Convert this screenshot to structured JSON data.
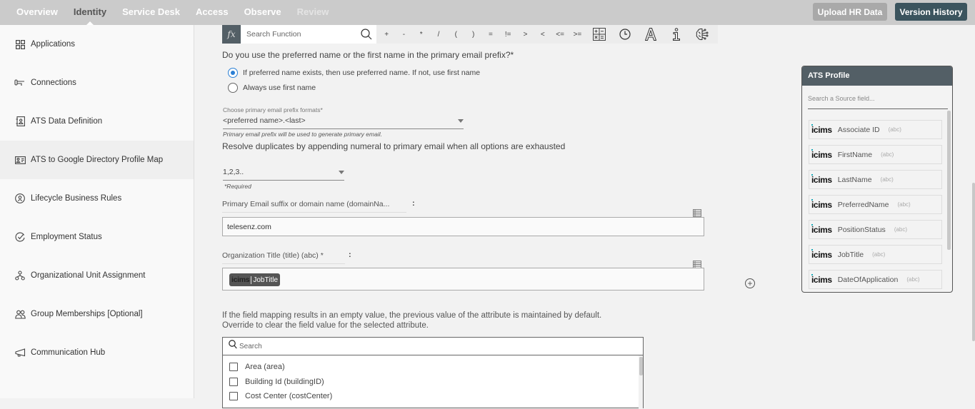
{
  "topnav": {
    "tabs": [
      {
        "label": "Overview",
        "state": "normal"
      },
      {
        "label": "Identity",
        "state": "active"
      },
      {
        "label": "Service Desk",
        "state": "normal"
      },
      {
        "label": "Access",
        "state": "normal"
      },
      {
        "label": "Observe",
        "state": "normal"
      },
      {
        "label": "Review",
        "state": "disabled"
      }
    ],
    "upload_label": "Upload HR Data",
    "version_label": "Version History"
  },
  "sidebar": {
    "items": [
      {
        "label": "Applications",
        "icon": "grid-icon"
      },
      {
        "label": "Connections",
        "icon": "key-connector-icon"
      },
      {
        "label": "ATS Data Definition",
        "icon": "contact-book-icon"
      },
      {
        "label": "ATS to Google Directory Profile Map",
        "icon": "id-card-icon",
        "active": true
      },
      {
        "label": "Lifecycle Business Rules",
        "icon": "user-circle-icon"
      },
      {
        "label": "Employment Status",
        "icon": "check-circle-icon"
      },
      {
        "label": "Organizational Unit Assignment",
        "icon": "org-tree-icon"
      },
      {
        "label": "Group Memberships [Optional]",
        "icon": "users-icon"
      },
      {
        "label": "Communication Hub",
        "icon": "megaphone-icon"
      }
    ]
  },
  "toolbar": {
    "fx_label": "fx",
    "search_placeholder": "Search Function",
    "operators": [
      "+",
      "-",
      "*",
      "/",
      "(",
      ")",
      "=",
      "!=",
      ">",
      "<",
      "<=",
      ">="
    ]
  },
  "form": {
    "name_question": "Do you use the preferred name or the first name in the primary email prefix?*",
    "radio_options": [
      {
        "label": "If preferred name exists, then use preferred name. If not, use first name",
        "selected": true
      },
      {
        "label": "Always use first name",
        "selected": false
      }
    ],
    "prefix_label": "Choose primary email prefix formats*",
    "prefix_value": "<preferred name>.<last>",
    "prefix_hint": "Primary email prefix will be used to generate primary email.",
    "duplicates_text": "Resolve duplicates by appending numeral to primary email when all options are exhausted",
    "duplicates_value": "1,2,3..",
    "duplicates_hint": "*Required",
    "domain_label": "Primary Email suffix or domain name (domainNa...",
    "domain_colon": ":",
    "domain_value": "telesenz.com",
    "title_label": "Organization Title (title) (abc) *",
    "title_colon": ":",
    "title_chip_brand": "icims",
    "title_chip_field": "JobTitle",
    "add_symbol": "+",
    "info_line1": "If the field mapping results in an empty value, the previous value of the attribute is maintained by default.",
    "info_line2": "Override to clear the field value for the selected attribute.",
    "attr_search_placeholder": "Search",
    "attributes": [
      {
        "label": "Area (area)",
        "checked": false
      },
      {
        "label": "Building Id (buildingID)",
        "checked": false
      },
      {
        "label": "Cost Center (costCenter)",
        "checked": false
      }
    ]
  },
  "ats_profile": {
    "title": "ATS Profile",
    "search_placeholder": "Search a Source field...",
    "brand": "icims",
    "fields": [
      {
        "name": "Associate ID",
        "type": "(abc)"
      },
      {
        "name": "FirstName",
        "type": "(abc)"
      },
      {
        "name": "LastName",
        "type": "(abc)"
      },
      {
        "name": "PreferredName",
        "type": "(abc)"
      },
      {
        "name": "PositionStatus",
        "type": "(abc)"
      },
      {
        "name": "JobTitle",
        "type": "(abc)"
      },
      {
        "name": "DateOfApplication",
        "type": "(abc)"
      }
    ]
  },
  "colors": {
    "topbar": "#cbcbcb",
    "primary_button": "#3b545e",
    "panel_header": "#535f66",
    "radio_accent": "#2a7fd4",
    "brand_dot": "#18a9b8"
  }
}
